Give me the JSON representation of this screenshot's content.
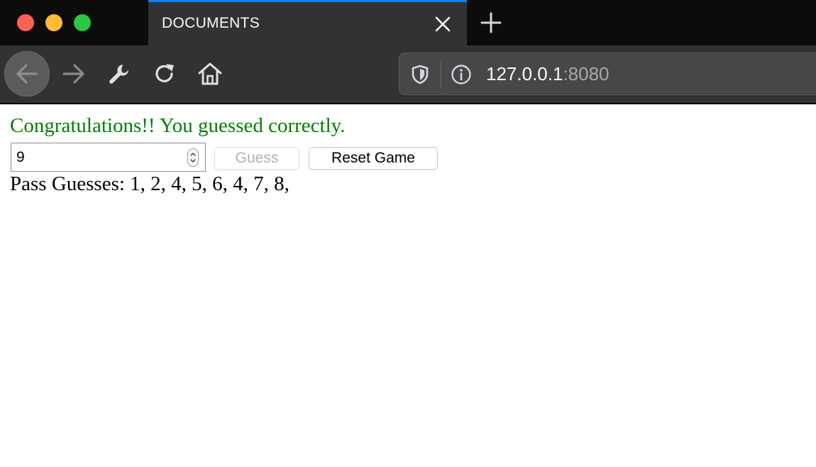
{
  "window": {
    "controls": [
      "close",
      "minimize",
      "zoom"
    ],
    "colors": {
      "close": "#fe5f57",
      "minimize": "#febc2e",
      "zoom": "#28c840"
    }
  },
  "tab": {
    "title": "DOCUMENTS",
    "close_icon": "close-icon",
    "accent": "#0a84ff"
  },
  "new_tab": {
    "icon": "plus-icon"
  },
  "toolbar": {
    "back_icon": "arrow-left-icon",
    "forward_icon": "arrow-right-icon",
    "tools_icon": "wrench-icon",
    "reload_icon": "reload-icon",
    "home_icon": "home-icon"
  },
  "urlbar": {
    "host": "127.0.0.1",
    "port": ":8080",
    "shield_icon": "shield-icon",
    "info_icon": "info-icon"
  },
  "game": {
    "message": "Congratulations!! You guessed correctly.",
    "message_color": "#008000",
    "guess_value": "9",
    "guess_button": "Guess",
    "guess_disabled": true,
    "reset_button": "Reset Game",
    "past_guesses": "Pass Guesses: 1, 2, 4, 5, 6, 4, 7, 8,"
  }
}
